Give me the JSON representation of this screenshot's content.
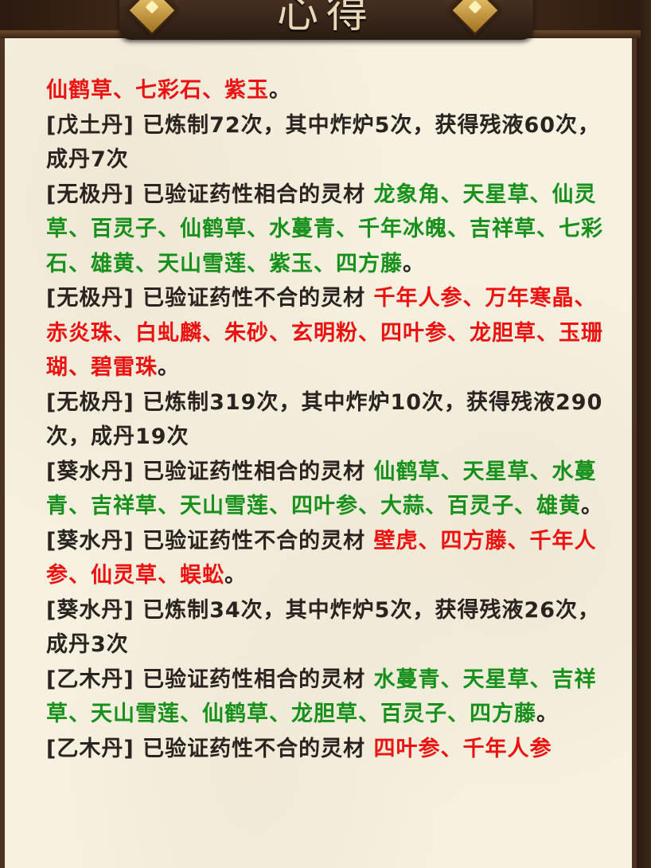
{
  "panel": {
    "title": "心得"
  },
  "colors": {
    "good_herb": "#17901c",
    "bad_herb": "#ec1212",
    "text": "#2a2420",
    "parchment": "#f6f1e0"
  },
  "icons": {
    "title_ornament": "gold-diamond-ornament-icon"
  },
  "entries": [
    {
      "id": "e0",
      "prefix": "",
      "herbs": "仙鹤草、七彩石、紫玉",
      "suffix": "。",
      "herb_type": "bad"
    },
    {
      "id": "e1",
      "prefix": "[戊土丹] 已炼制72次，其中炸炉5次，获得残液60次，成丹7次",
      "herbs": "",
      "suffix": "",
      "herb_type": ""
    },
    {
      "id": "e2",
      "prefix": "[无极丹] 已验证药性相合的灵材 ",
      "herbs": "龙象角、天星草、仙灵草、百灵子、仙鹤草、水蔓青、千年冰魄、吉祥草、七彩石、雄黄、天山雪莲、紫玉、四方藤",
      "suffix": "。",
      "herb_type": "good"
    },
    {
      "id": "e3",
      "prefix": "[无极丹] 已验证药性不合的灵材 ",
      "herbs": "千年人参、万年寒晶、赤炎珠、白虬麟、朱砂、玄明粉、四叶参、龙胆草、玉珊瑚、碧雷珠",
      "suffix": "。",
      "herb_type": "bad"
    },
    {
      "id": "e4",
      "prefix": "[无极丹] 已炼制319次，其中炸炉10次，获得残液290次，成丹19次",
      "herbs": "",
      "suffix": "",
      "herb_type": ""
    },
    {
      "id": "e5",
      "prefix": "[葵水丹] 已验证药性相合的灵材 ",
      "herbs": "仙鹤草、天星草、水蔓青、吉祥草、天山雪莲、四叶参、大蒜、百灵子、雄黄",
      "suffix": "。",
      "herb_type": "good"
    },
    {
      "id": "e6",
      "prefix": "[葵水丹] 已验证药性不合的灵材 ",
      "herbs": "壁虎、四方藤、千年人参、仙灵草、蜈蚣",
      "suffix": "。",
      "herb_type": "bad"
    },
    {
      "id": "e7",
      "prefix": "[葵水丹] 已炼制34次，其中炸炉5次，获得残液26次，成丹3次",
      "herbs": "",
      "suffix": "",
      "herb_type": ""
    },
    {
      "id": "e8",
      "prefix": "[乙木丹] 已验证药性相合的灵材 ",
      "herbs": "水蔓青、天星草、吉祥草、天山雪莲、仙鹤草、龙胆草、百灵子、四方藤",
      "suffix": "。",
      "herb_type": "good"
    },
    {
      "id": "e9",
      "prefix": "[乙木丹] 已验证药性不合的灵材 ",
      "herbs": "四叶参、千年人参",
      "suffix": "",
      "herb_type": "bad"
    }
  ]
}
